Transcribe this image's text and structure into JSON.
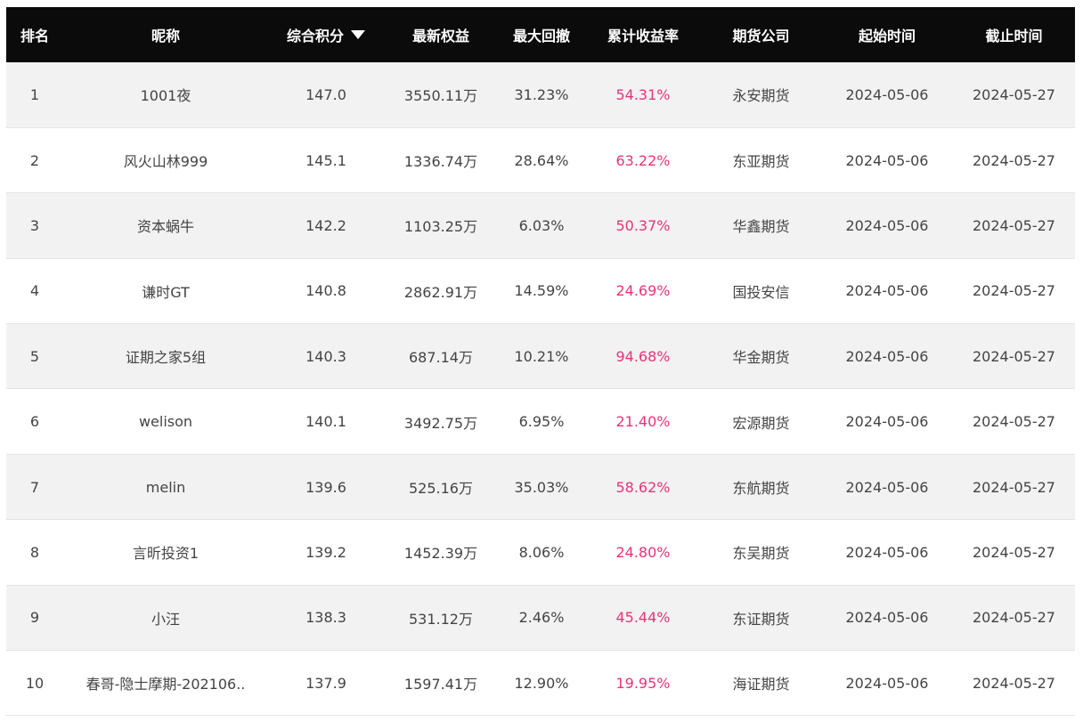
{
  "table": {
    "headers": {
      "rank": "排名",
      "nickname": "昵称",
      "score": "综合积分",
      "equity": "最新权益",
      "drawdown": "最大回撤",
      "return_rate": "累计收益率",
      "company": "期货公司",
      "start_date": "起始时间",
      "end_date": "截止时间"
    },
    "sort_column": "score",
    "sort_direction": "descending",
    "rate_color": "#e8337a",
    "header_bg": "#0b0b0b",
    "rows": [
      {
        "rank": "1",
        "nickname": "1001夜",
        "score": "147.0",
        "equity": "3550.11万",
        "drawdown": "31.23%",
        "return_rate": "54.31%",
        "company": "永安期货",
        "start_date": "2024-05-06",
        "end_date": "2024-05-27"
      },
      {
        "rank": "2",
        "nickname": "风火山林999",
        "score": "145.1",
        "equity": "1336.74万",
        "drawdown": "28.64%",
        "return_rate": "63.22%",
        "company": "东亚期货",
        "start_date": "2024-05-06",
        "end_date": "2024-05-27"
      },
      {
        "rank": "3",
        "nickname": "资本蜗牛",
        "score": "142.2",
        "equity": "1103.25万",
        "drawdown": "6.03%",
        "return_rate": "50.37%",
        "company": "华鑫期货",
        "start_date": "2024-05-06",
        "end_date": "2024-05-27"
      },
      {
        "rank": "4",
        "nickname": "谦时GT",
        "score": "140.8",
        "equity": "2862.91万",
        "drawdown": "14.59%",
        "return_rate": "24.69%",
        "company": "国投安信",
        "start_date": "2024-05-06",
        "end_date": "2024-05-27"
      },
      {
        "rank": "5",
        "nickname": "证期之家5组",
        "score": "140.3",
        "equity": "687.14万",
        "drawdown": "10.21%",
        "return_rate": "94.68%",
        "company": "华金期货",
        "start_date": "2024-05-06",
        "end_date": "2024-05-27"
      },
      {
        "rank": "6",
        "nickname": "welison",
        "score": "140.1",
        "equity": "3492.75万",
        "drawdown": "6.95%",
        "return_rate": "21.40%",
        "company": "宏源期货",
        "start_date": "2024-05-06",
        "end_date": "2024-05-27"
      },
      {
        "rank": "7",
        "nickname": "melin",
        "score": "139.6",
        "equity": "525.16万",
        "drawdown": "35.03%",
        "return_rate": "58.62%",
        "company": "东航期货",
        "start_date": "2024-05-06",
        "end_date": "2024-05-27"
      },
      {
        "rank": "8",
        "nickname": "言昕投资1",
        "score": "139.2",
        "equity": "1452.39万",
        "drawdown": "8.06%",
        "return_rate": "24.80%",
        "company": "东吴期货",
        "start_date": "2024-05-06",
        "end_date": "2024-05-27"
      },
      {
        "rank": "9",
        "nickname": "小汪",
        "score": "138.3",
        "equity": "531.12万",
        "drawdown": "2.46%",
        "return_rate": "45.44%",
        "company": "东证期货",
        "start_date": "2024-05-06",
        "end_date": "2024-05-27"
      },
      {
        "rank": "10",
        "nickname": "春哥-隐士摩期-202106..",
        "score": "137.9",
        "equity": "1597.41万",
        "drawdown": "12.90%",
        "return_rate": "19.95%",
        "company": "海证期货",
        "start_date": "2024-05-06",
        "end_date": "2024-05-27"
      }
    ]
  }
}
